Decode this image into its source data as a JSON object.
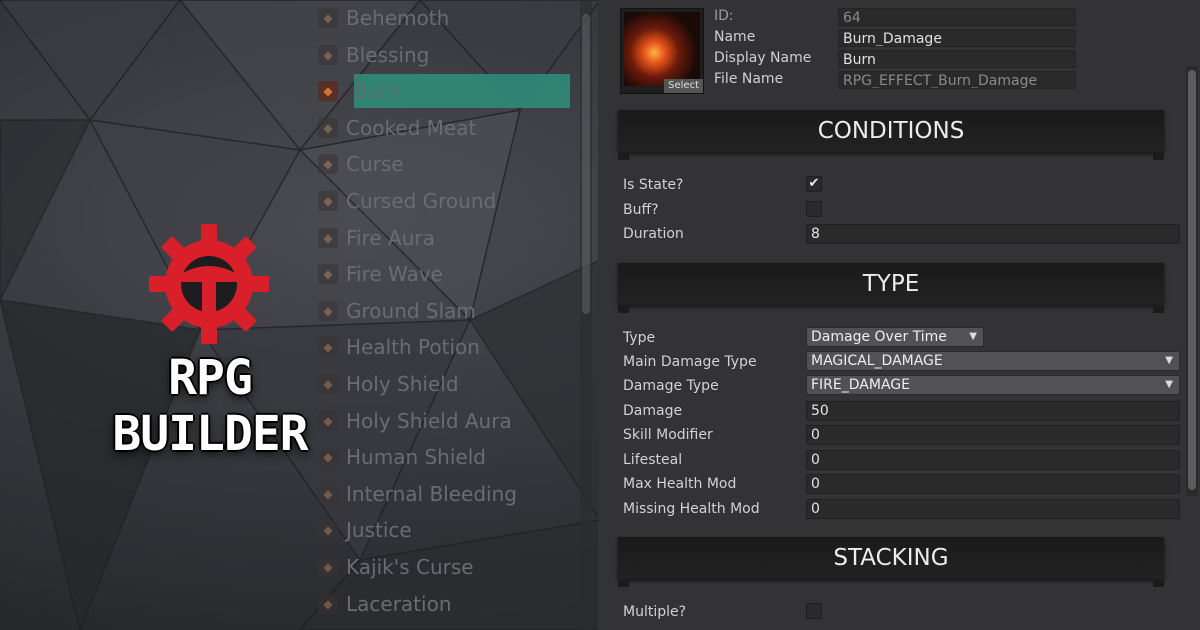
{
  "logo": {
    "text": "RPG BUILDER",
    "brand_color": "#d81f2a"
  },
  "effect_list": {
    "items": [
      {
        "label": "Behemoth",
        "icon": "behemoth-icon"
      },
      {
        "label": "Blessing",
        "icon": "blessing-icon"
      },
      {
        "label": "Burn",
        "icon": "fire-icon",
        "selected": true
      },
      {
        "label": "Cooked Meat",
        "icon": "meat-icon"
      },
      {
        "label": "Curse",
        "icon": "curse-icon"
      },
      {
        "label": "Cursed Ground",
        "icon": "cursed-ground-icon"
      },
      {
        "label": "Fire Aura",
        "icon": "fire-aura-icon"
      },
      {
        "label": "Fire Wave",
        "icon": "fire-wave-icon"
      },
      {
        "label": "Ground Slam",
        "icon": "ground-slam-icon"
      },
      {
        "label": "Health Potion",
        "icon": "potion-icon"
      },
      {
        "label": "Holy Shield",
        "icon": "shield-icon"
      },
      {
        "label": "Holy Shield Aura",
        "icon": "shield-aura-icon"
      },
      {
        "label": "Human Shield",
        "icon": "human-shield-icon"
      },
      {
        "label": "Internal Bleeding",
        "icon": "bleeding-icon"
      },
      {
        "label": "Justice",
        "icon": "justice-icon"
      },
      {
        "label": "Kajik's Curse",
        "icon": "kajik-curse-icon"
      },
      {
        "label": "Laceration",
        "icon": "laceration-icon"
      }
    ],
    "selected_color": "#2f8f7d"
  },
  "header": {
    "thumbnail_button": "Select",
    "id_label": "ID:",
    "id_value": "64",
    "name_label": "Name",
    "name_value": "Burn_Damage",
    "display_name_label": "Display Name",
    "display_name_value": "Burn",
    "file_name_label": "File Name",
    "file_name_value": "RPG_EFFECT_Burn_Damage"
  },
  "conditions": {
    "title": "CONDITIONS",
    "is_state_label": "Is State?",
    "is_state_checked": true,
    "buff_label": "Buff?",
    "buff_checked": false,
    "duration_label": "Duration",
    "duration_value": "8"
  },
  "type_section": {
    "title": "TYPE",
    "type_label": "Type",
    "type_value": "Damage Over Time",
    "main_damage_type_label": "Main Damage Type",
    "main_damage_type_value": "MAGICAL_DAMAGE",
    "damage_type_label": "Damage Type",
    "damage_type_value": "FIRE_DAMAGE",
    "damage_label": "Damage",
    "damage_value": "50",
    "skill_modifier_label": "Skill Modifier",
    "skill_modifier_value": "0",
    "lifesteal_label": "Lifesteal",
    "lifesteal_value": "0",
    "max_health_mod_label": "Max Health Mod",
    "max_health_mod_value": "0",
    "missing_health_mod_label": "Missing Health Mod",
    "missing_health_mod_value": "0"
  },
  "stacking": {
    "title": "STACKING",
    "multiple_label": "Multiple?",
    "multiple_checked": false
  },
  "glyphs": {
    "check": "✔",
    "caret": "▼",
    "item_icon": "◆"
  }
}
